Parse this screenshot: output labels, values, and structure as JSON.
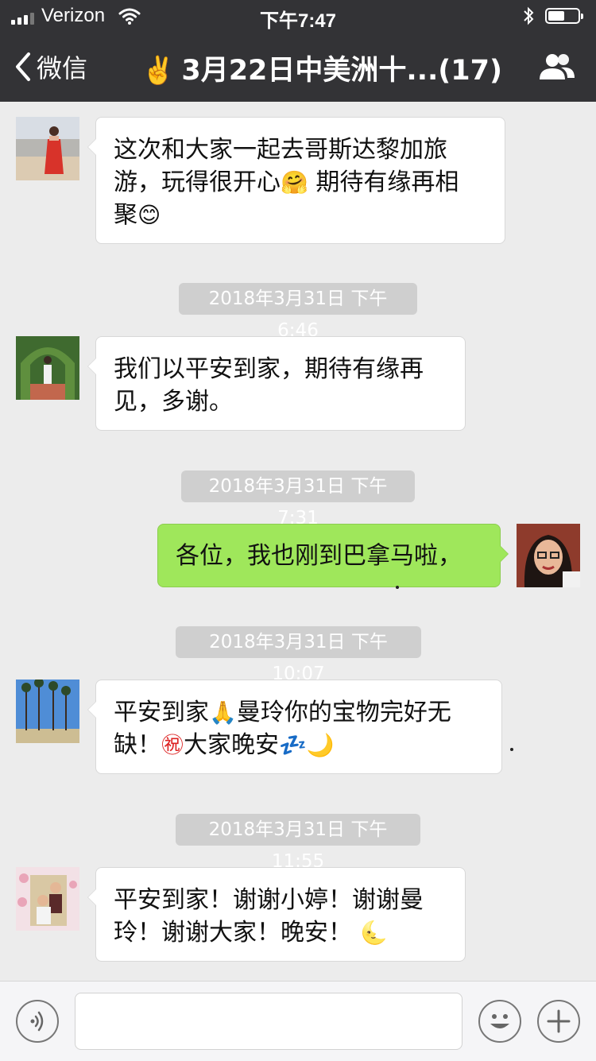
{
  "status_bar": {
    "carrier": "Verizon",
    "time": "下午7:47"
  },
  "nav": {
    "back_label": "微信",
    "title_emoji": "✌️",
    "title": "3月22日中美洲十...(17)",
    "back_icon": "chevron-left-icon",
    "members_icon": "group-icon"
  },
  "messages": [
    {
      "side": "left",
      "avatar": "woman-red-dress-avatar",
      "text_lines": [
        "这次和大家一起去哥斯达黎加旅",
        "游，玩得很开心",
        "期待有缘再相",
        "聚"
      ],
      "emojis": [
        "🤗",
        "😊"
      ]
    },
    {
      "timestamp": "2018年3月31日 下午6:46"
    },
    {
      "side": "left",
      "avatar": "woman-garden-arch-avatar",
      "text_lines": [
        "我们以平安到家，期待有缘再",
        "见，多谢。"
      ]
    },
    {
      "timestamp": "2018年3月31日 下午7:31"
    },
    {
      "side": "right",
      "avatar": "woman-glasses-avatar",
      "text_lines": [
        "各位，我也刚到巴拿马啦，"
      ]
    },
    {
      "timestamp": "2018年3月31日 下午10:07"
    },
    {
      "side": "left",
      "avatar": "palm-trees-avatar",
      "text_lines": [
        "平安到家",
        "曼玲你的宝物完好无",
        "缺！",
        "大家晚安"
      ],
      "emojis": [
        "🙏",
        "㊗",
        "💤",
        "🌙"
      ]
    },
    {
      "timestamp": "2018年3月31日 下午11:55"
    },
    {
      "side": "left",
      "avatar": "couple-flowers-avatar",
      "text_lines": [
        "平安到家！谢谢小婷！谢谢曼",
        "玲！谢谢大家！晚安！"
      ],
      "emojis": [
        "🌜"
      ]
    }
  ],
  "input_bar": {
    "voice_icon": "voice-icon",
    "emoji_icon": "smiley-icon",
    "plus_icon": "plus-icon",
    "placeholder": ""
  },
  "colors": {
    "header_bg": "#333336",
    "chat_bg": "#ececec",
    "my_bubble": "#9fe75b",
    "timestamp_bg": "#cfcfcf"
  }
}
